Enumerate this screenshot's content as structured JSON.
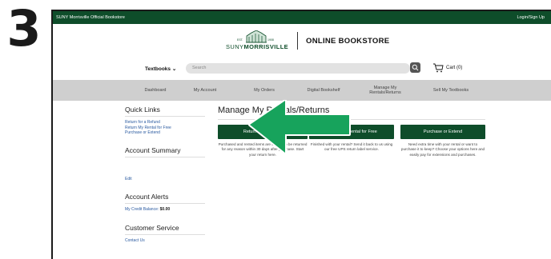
{
  "step_number": "3",
  "topbar": {
    "store_name": "SUNY Morrisville Official Bookstore",
    "account_link": "Login/Sign Up"
  },
  "header": {
    "logo_est": "EST.",
    "logo_year": "1908",
    "logo_suny": "SUNY",
    "logo_name": "MORRISVILLE",
    "title": "ONLINE BOOKSTORE"
  },
  "search": {
    "textbooks_label": "Textbooks",
    "placeholder": "Search"
  },
  "cart": {
    "label": "Cart (0)"
  },
  "nav": {
    "dashboard": "Dashboard",
    "my_account": "My Account",
    "my_orders": "My Orders",
    "digital_bookshelf": "Digital Bookshelf",
    "manage_rentals": "Manage My Rentals/Returns",
    "sell_textbooks": "Sell My Textbooks"
  },
  "sidebar": {
    "quick_links_heading": "Quick Links",
    "links": [
      "Return for a Refund",
      "Return My Rental for Free",
      "Purchase or Extend"
    ],
    "account_summary_heading": "Account Summary",
    "edit_link": "Edit",
    "account_alerts_heading": "Account Alerts",
    "credit_balance_label": "My Credit Balance:",
    "credit_balance_value": "$0.00",
    "customer_service_heading": "Customer Service",
    "contact_us": "Contact Us"
  },
  "main": {
    "heading": "Manage My Rentals/Returns",
    "buttons": [
      "Return for a Refund",
      "Return My Rental for Free",
      "Purchase or Extend"
    ],
    "descriptions": [
      "Purchased and rented items are eligible to be returned for any reason within 30 days after purchase. Start your return here.",
      "Finished with your rental? Send it back to us using our free UPS return label service.",
      "Need extra time with your rental or want to purchase it to keep? Choose your options here and easily pay for extensions and purchases."
    ]
  },
  "colors": {
    "brand_green": "#0e4d2a",
    "arrow_green": "#17a35c",
    "nav_gray": "#cfcfcf",
    "link_blue": "#2a5aa0"
  }
}
